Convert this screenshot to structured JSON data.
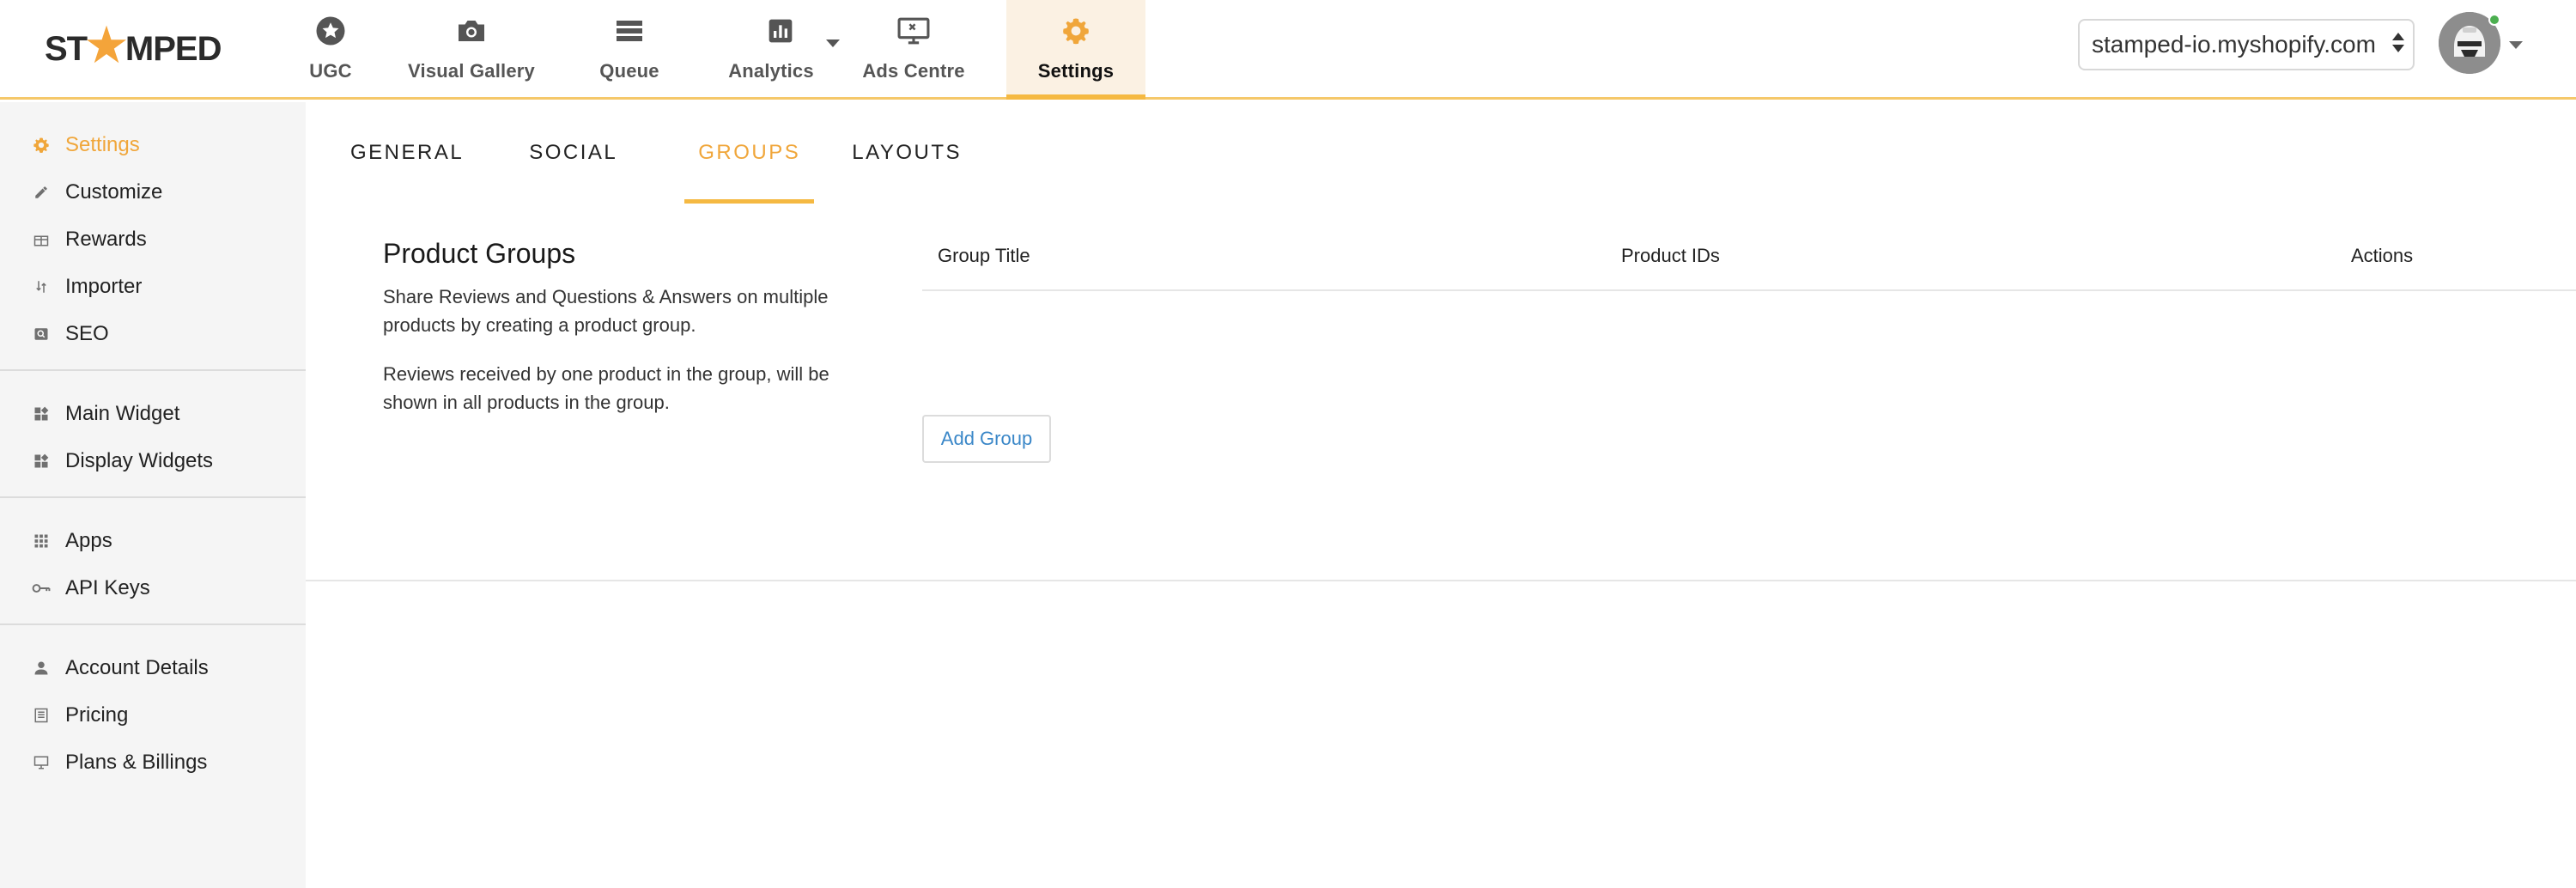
{
  "brand": {
    "logo_left": "ST",
    "logo_right": "MPED"
  },
  "nav": {
    "items": [
      {
        "label": "UGC",
        "icon": "star-badge-icon"
      },
      {
        "label": "Visual Gallery",
        "icon": "camera-icon"
      },
      {
        "label": "Queue",
        "icon": "list-icon"
      },
      {
        "label": "Analytics",
        "icon": "bar-chart-icon"
      },
      {
        "label": "Ads Centre",
        "icon": "monitor-icon"
      },
      {
        "label": "Settings",
        "icon": "gear-icon"
      }
    ],
    "active": "Settings"
  },
  "store_selector": {
    "value": "stamped-io.myshopify.com"
  },
  "sidebar": {
    "groups": [
      [
        {
          "label": "Settings",
          "icon": "gear-icon"
        },
        {
          "label": "Customize",
          "icon": "pencil-icon"
        },
        {
          "label": "Rewards",
          "icon": "gift-icon"
        },
        {
          "label": "Importer",
          "icon": "import-arrows-icon"
        },
        {
          "label": "SEO",
          "icon": "search-box-icon"
        }
      ],
      [
        {
          "label": "Main Widget",
          "icon": "widgets-icon"
        },
        {
          "label": "Display Widgets",
          "icon": "widgets-icon"
        }
      ],
      [
        {
          "label": "Apps",
          "icon": "apps-grid-icon"
        },
        {
          "label": "API Keys",
          "icon": "key-icon"
        }
      ],
      [
        {
          "label": "Account Details",
          "icon": "person-icon"
        },
        {
          "label": "Pricing",
          "icon": "document-icon"
        },
        {
          "label": "Plans & Billings",
          "icon": "desktop-icon"
        }
      ]
    ],
    "active": "Settings"
  },
  "tabs": {
    "items": [
      "GENERAL",
      "SOCIAL",
      "GROUPS",
      "LAYOUTS"
    ],
    "active": "GROUPS"
  },
  "product_groups": {
    "title": "Product Groups",
    "description_1": "Share Reviews and Questions & Answers on multiple products by creating a product group.",
    "description_2": "Reviews received by one product in the group, will be shown in all products in the group.",
    "columns": [
      "Group Title",
      "Product IDs",
      "Actions"
    ],
    "add_button": "Add Group"
  },
  "colors": {
    "accent": "#f0a63a",
    "link": "#3a87c8",
    "active_nav_bg": "#fbf1e3"
  }
}
